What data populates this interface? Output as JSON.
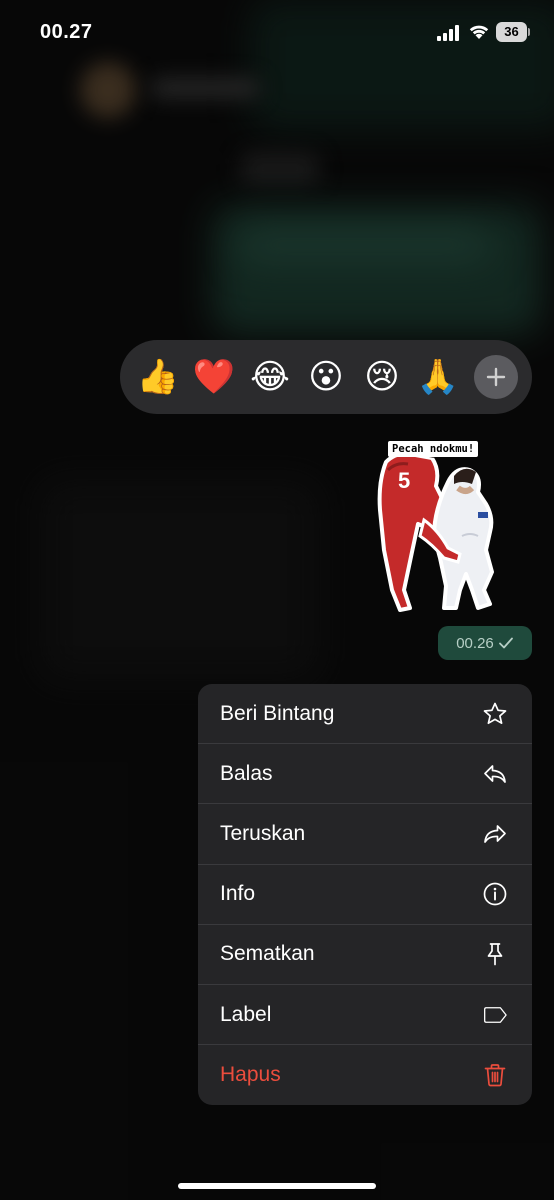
{
  "status_bar": {
    "time": "00.27",
    "battery": "36"
  },
  "reactions": [
    {
      "emoji": "👍",
      "name": "thumbs-up"
    },
    {
      "emoji": "❤️",
      "name": "heart"
    },
    {
      "emoji": "😂",
      "name": "tears-of-joy"
    },
    {
      "emoji": "😮",
      "name": "surprised"
    },
    {
      "emoji": "😢",
      "name": "crying"
    },
    {
      "emoji": "🙏",
      "name": "folded-hands"
    }
  ],
  "message": {
    "sticker_caption": "Pecah ndokmu!",
    "sticker_jersey_number": "5",
    "time": "00.26"
  },
  "menu": {
    "items": [
      {
        "label": "Beri Bintang",
        "icon": "star-icon"
      },
      {
        "label": "Balas",
        "icon": "reply-icon"
      },
      {
        "label": "Teruskan",
        "icon": "forward-icon"
      },
      {
        "label": "Info",
        "icon": "info-icon"
      },
      {
        "label": "Sematkan",
        "icon": "pin-icon"
      },
      {
        "label": "Label",
        "icon": "label-tag-icon"
      },
      {
        "label": "Hapus",
        "icon": "trash-icon"
      }
    ]
  },
  "colors": {
    "background": "#0c0c0c",
    "menu_bg": "#252527",
    "destructive": "#eb4d3d",
    "bubble_green": "#1f4a3c"
  }
}
